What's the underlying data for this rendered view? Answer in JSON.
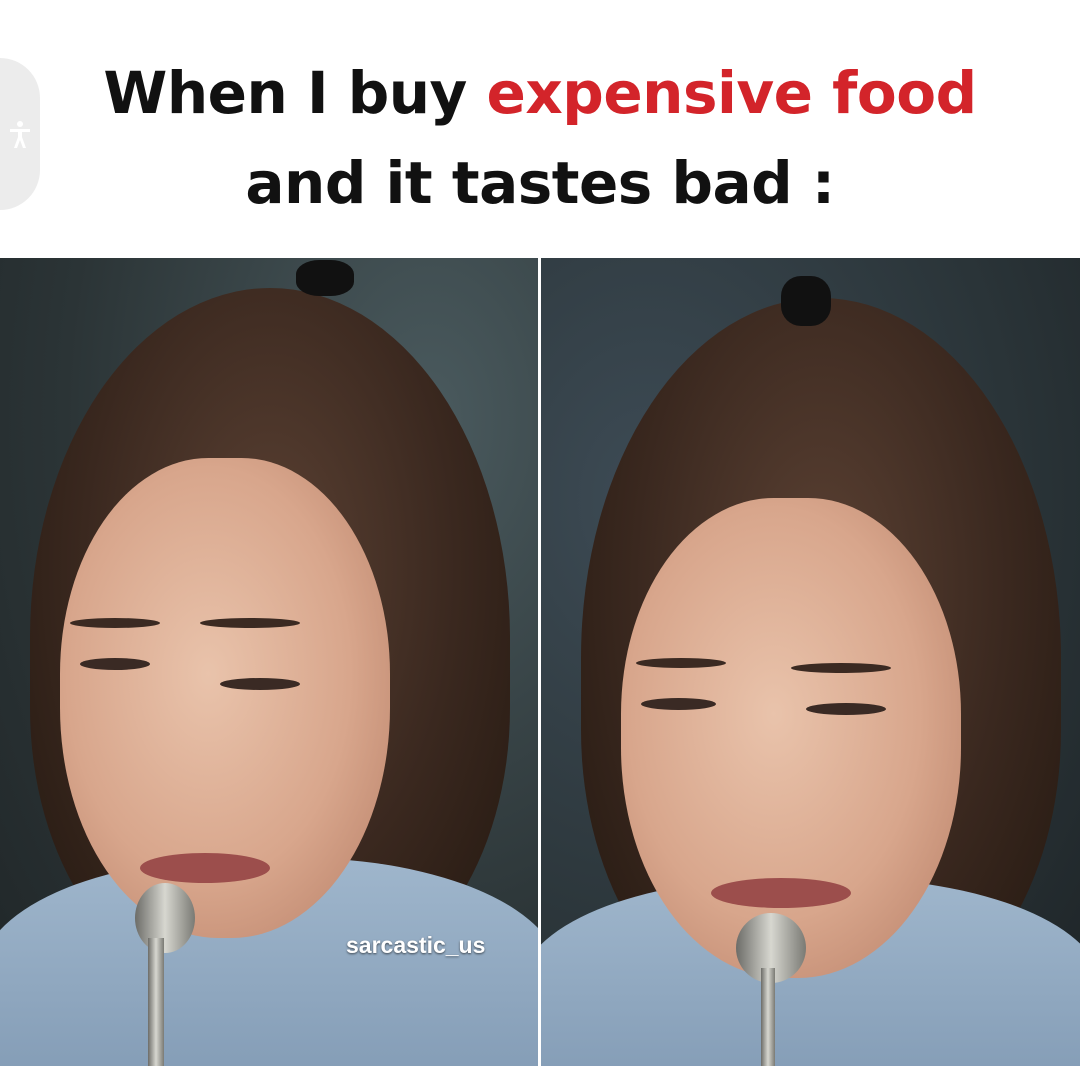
{
  "caption": {
    "line1_prefix": "When I buy ",
    "line1_highlight": "expensive food",
    "line2": "and it tastes bad :",
    "highlight_color": "#d3242a"
  },
  "watermark": "sarcastic_us",
  "accessibility_button": {
    "icon": "accessibility-person-icon"
  },
  "panels": [
    {
      "description_icon": "photo"
    },
    {
      "description_icon": "photo"
    }
  ]
}
